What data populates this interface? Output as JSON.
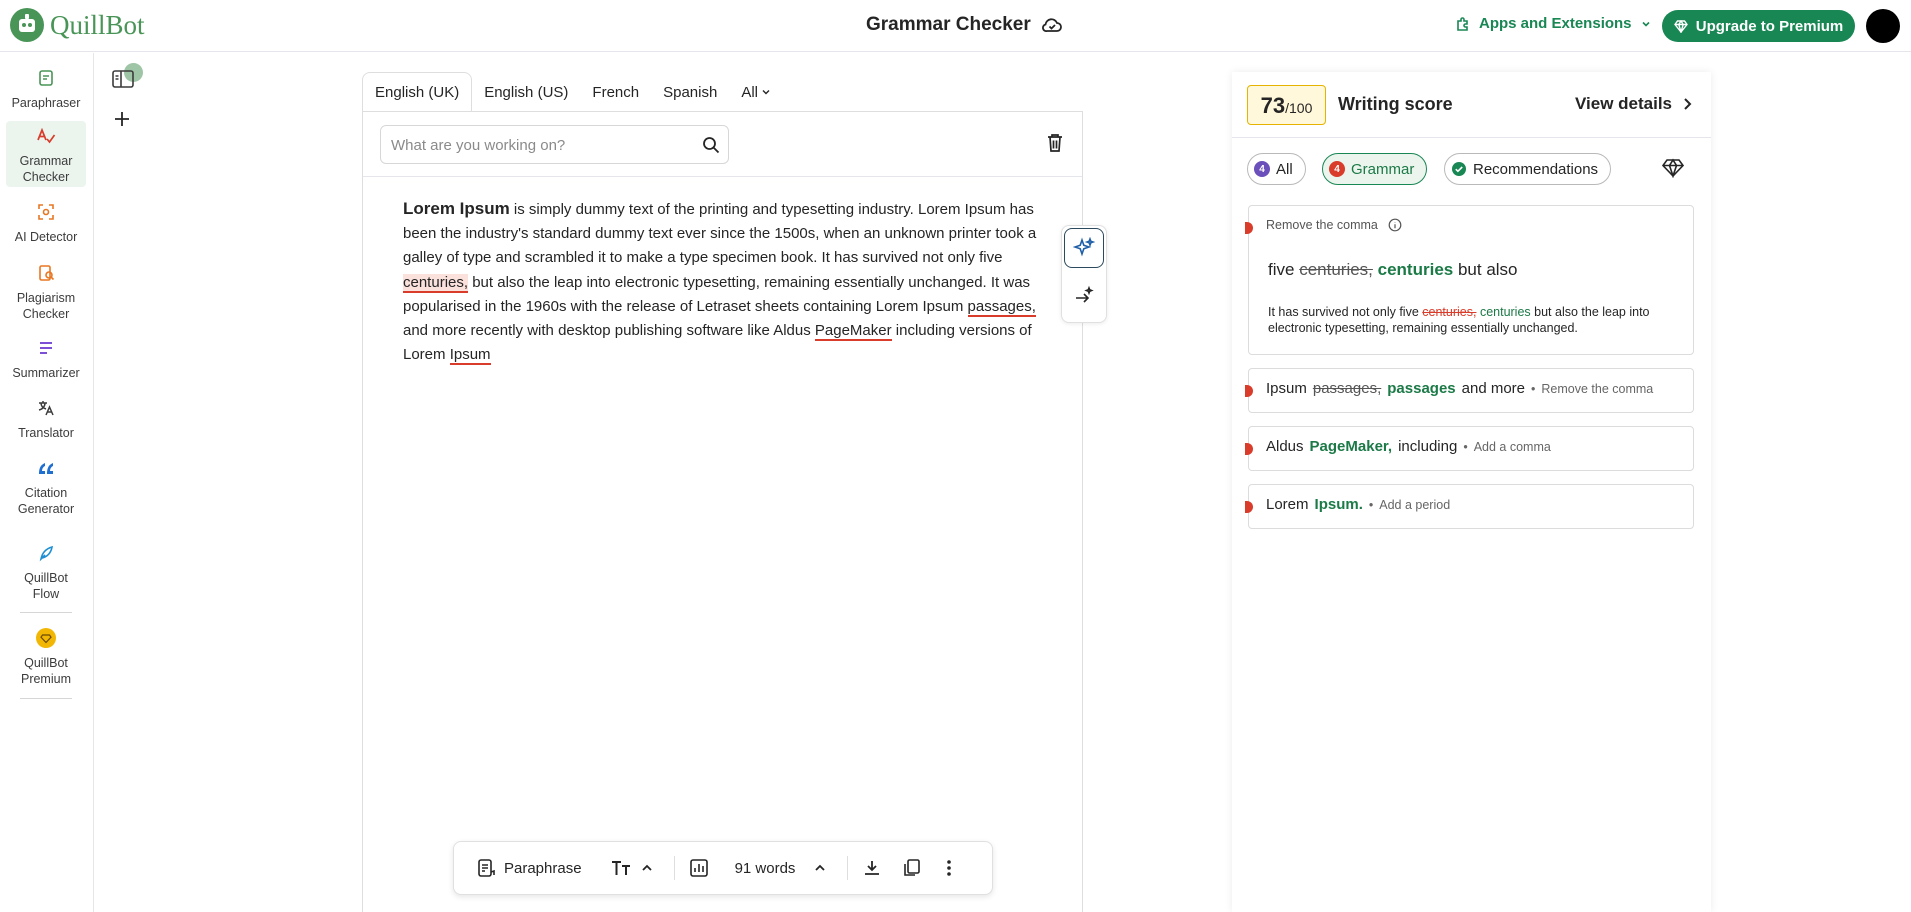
{
  "brand": {
    "name": "QuillBot",
    "color": "#499557"
  },
  "header": {
    "title": "Grammar Checker",
    "cloud_icon": "cloud-sync-icon",
    "apps_label": "Apps and Extensions",
    "upgrade_label": "Upgrade to Premium",
    "accent": "#198754"
  },
  "sidebar": {
    "items": [
      {
        "label": "Paraphraser",
        "icon": "paraphraser-icon",
        "active": false
      },
      {
        "label": "Grammar Checker",
        "icon": "grammar-checker-icon",
        "active": true
      },
      {
        "label": "AI Detector",
        "icon": "ai-detector-icon",
        "active": false
      },
      {
        "label": "Plagiarism Checker",
        "icon": "plagiarism-checker-icon",
        "active": false
      },
      {
        "label": "Summarizer",
        "icon": "summarizer-icon",
        "active": false
      },
      {
        "label": "Translator",
        "icon": "translator-icon",
        "active": false
      },
      {
        "label": "Citation Generator",
        "icon": "citation-generator-icon",
        "active": false
      },
      {
        "label": "QuillBot Flow",
        "icon": "quillbot-flow-icon",
        "active": false
      },
      {
        "label": "QuillBot Premium",
        "icon": "premium-icon",
        "active": false
      }
    ]
  },
  "editor": {
    "tabs": [
      {
        "label": "English (UK)",
        "active": true
      },
      {
        "label": "English (US)",
        "active": false
      },
      {
        "label": "French",
        "active": false
      },
      {
        "label": "Spanish",
        "active": false
      },
      {
        "label": "All",
        "active": false
      }
    ],
    "search_placeholder": "What are you working on?",
    "text": {
      "lead": "Lorem Ipsum",
      "p1": " is simply dummy text of the printing and typesetting industry. Lorem Ipsum has been the industry's standard dummy text ever since the 1500s, when an unknown printer took a galley of type and scrambled it to make a type specimen book. It has survived not only five ",
      "err1": "centuries,",
      "p2": " but also the leap into electronic typesetting, remaining essentially unchanged. It was popularised in the 1960s with the release of Letraset sheets containing Lorem Ipsum ",
      "err2": "passages,",
      "p3": " and more recently with desktop publishing software like Aldus ",
      "err3": "PageMaker",
      "p4": " including versions of Lorem ",
      "err4": "Ipsum"
    },
    "bottom_bar": {
      "paraphrase_label": "Paraphrase",
      "word_count": "91 words"
    }
  },
  "right_panel": {
    "score": {
      "value": "73",
      "max": "/100",
      "label": "Writing score"
    },
    "view_details": "View details",
    "filters": [
      {
        "label": "All",
        "count": "4",
        "color": "#6b4fbb",
        "active": false
      },
      {
        "label": "Grammar",
        "count": "4",
        "color": "#d93c2a",
        "active": true
      },
      {
        "label": "Recommendations",
        "count": "",
        "color": "#198754",
        "active": false
      }
    ],
    "expanded_card": {
      "title": "Remove the comma",
      "before": "five",
      "wrong": "centuries,",
      "fix": "centuries",
      "after": "but also",
      "context_pre": "It has survived not only five ",
      "context_wrong": "centuries,",
      "context_fix": "centuries",
      "context_post": " but also the leap into electronic typesetting, remaining essentially unchanged."
    },
    "mini_cards": [
      {
        "before": "Ipsum",
        "wrong": "passages,",
        "fix": "passages",
        "after": "and more",
        "note": "Remove the comma"
      },
      {
        "before": "Aldus",
        "wrong": "",
        "fix": "PageMaker,",
        "after": "including",
        "note": "Add a comma"
      },
      {
        "before": "Lorem",
        "wrong": "",
        "fix": "Ipsum.",
        "after": "",
        "note": "Add a period"
      }
    ]
  }
}
